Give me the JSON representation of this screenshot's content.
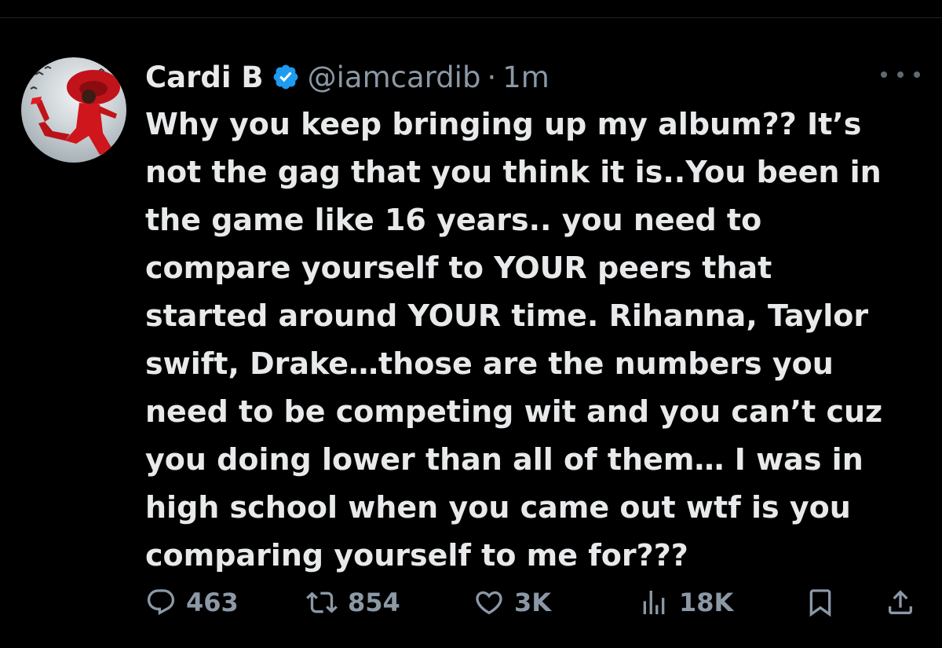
{
  "author": {
    "display_name": "Cardi B",
    "handle": "@iamcardib",
    "separator": "·",
    "timestamp": "1m",
    "verified": true,
    "verified_color": "#1d9bf0"
  },
  "tweet": {
    "lines": [
      "Why you keep bringing up my album?? It’s",
      "not the gag that you think it is..You been in",
      "the game like 16 years.. you need to",
      "compare yourself to YOUR peers that",
      "started around YOUR time. Rihanna, Taylor",
      "swift, Drake…those are the numbers you",
      "need to be competing wit and you can’t cuz",
      "you doing lower than all of them… I was in",
      "high school when you came out wtf is you",
      "comparing yourself to me for???"
    ]
  },
  "actions": {
    "replies": "463",
    "reposts": "854",
    "likes": "3K",
    "views": "18K"
  },
  "icons": {
    "more": "more-icon",
    "reply": "reply-icon",
    "repost": "repost-icon",
    "like": "heart-icon",
    "views": "views-icon",
    "bookmark": "bookmark-icon",
    "share": "share-icon"
  },
  "colors": {
    "background": "#000000",
    "text": "#e7e9ea",
    "secondary": "#8b98a5"
  }
}
